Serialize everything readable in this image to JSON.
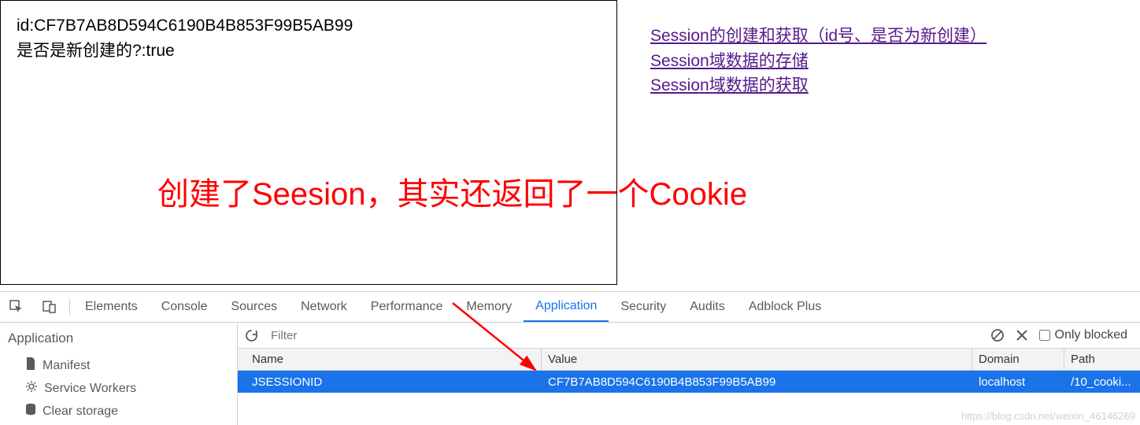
{
  "iframe": {
    "line1": "id:CF7B7AB8D594C6190B4B853F99B5AB99",
    "line2": "是否是新创建的?:true"
  },
  "links": [
    "Session的创建和获取（id号、是否为新创建）",
    "Session域数据的存储",
    "Session域数据的获取"
  ],
  "annotation": "创建了Seesion，其实还返回了一个Cookie",
  "devtools": {
    "tabs": [
      "Elements",
      "Console",
      "Sources",
      "Network",
      "Performance",
      "Memory",
      "Application",
      "Security",
      "Audits",
      "Adblock Plus"
    ],
    "active_tab": "Application",
    "filter_placeholder": "Filter",
    "only_blocked_label": "Only blocked",
    "sidebar": {
      "heading": "Application",
      "items": [
        {
          "icon": "file-icon",
          "label": "Manifest"
        },
        {
          "icon": "gear-icon",
          "label": "Service Workers"
        },
        {
          "icon": "storage-icon",
          "label": "Clear storage"
        }
      ]
    },
    "table": {
      "headers": {
        "name": "Name",
        "value": "Value",
        "domain": "Domain",
        "path": "Path"
      },
      "rows": [
        {
          "name": "JSESSIONID",
          "value": "CF7B7AB8D594C6190B4B853F99B5AB99",
          "domain": "localhost",
          "path": "/10_cooki..."
        }
      ]
    }
  },
  "watermark": "https://blog.csdn.net/weixin_46146269"
}
